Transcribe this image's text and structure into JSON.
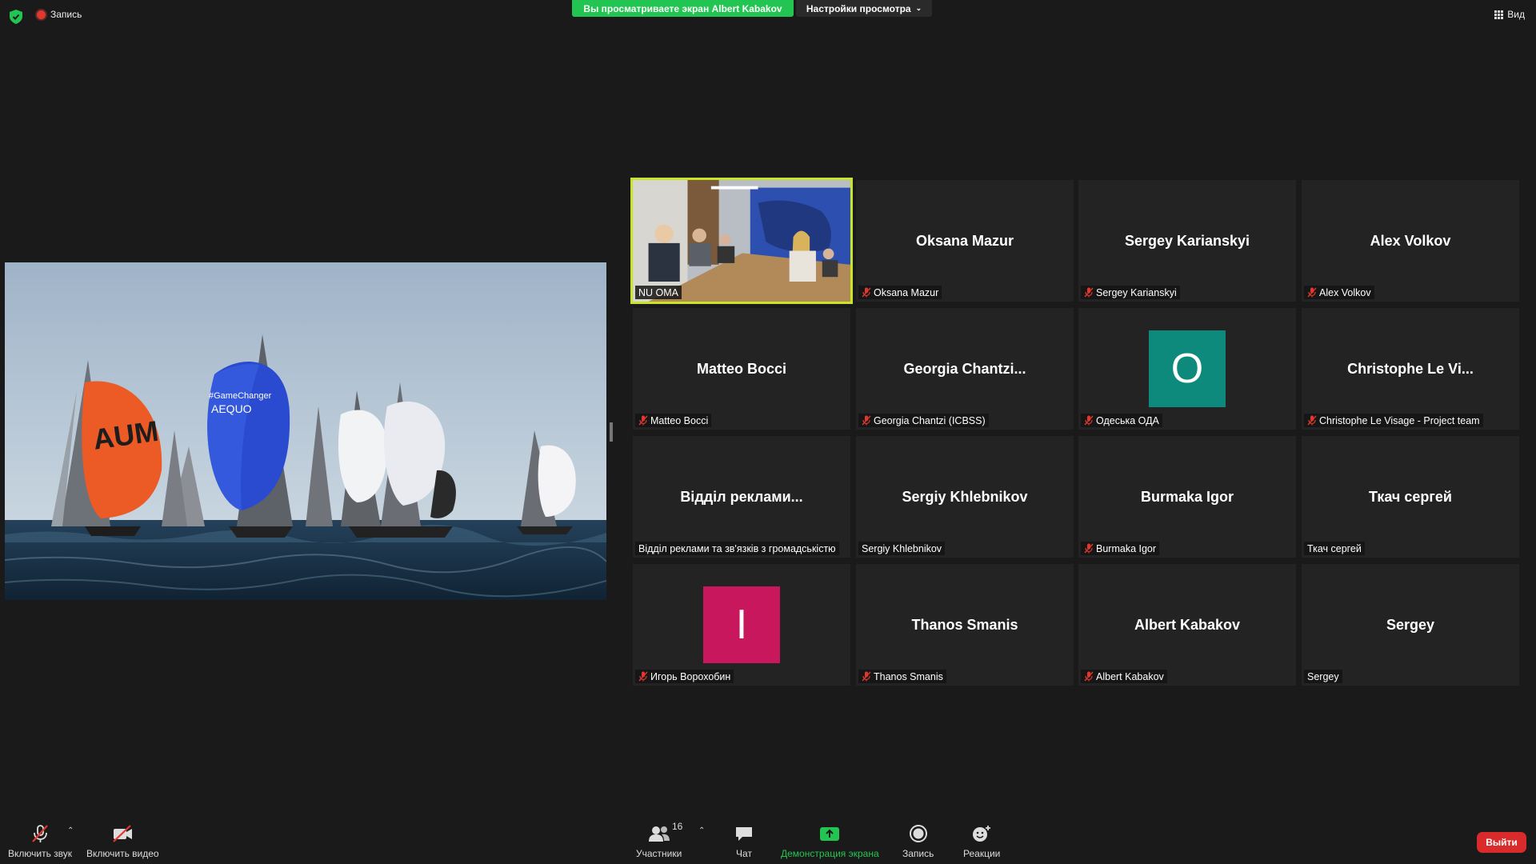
{
  "topbar": {
    "recording_label": "Запись",
    "share_banner": "Вы просматриваете экран Albert Kabakov",
    "view_options": "Настройки просмотра",
    "view_button": "Вид"
  },
  "participants": [
    {
      "display": "",
      "label": "NU OMA",
      "muted": false,
      "video": true,
      "active": true
    },
    {
      "display": "Oksana Mazur",
      "label": "Oksana Mazur",
      "muted": true
    },
    {
      "display": "Sergey Karianskyi",
      "label": "Sergey Karianskyi",
      "muted": true
    },
    {
      "display": "Alex Volkov",
      "label": "Alex Volkov",
      "muted": true
    },
    {
      "display": "Matteo Bocci",
      "label": "Matteo Bocci",
      "muted": true
    },
    {
      "display": "Georgia  Chantzi...",
      "label": "Georgia Chantzi (ICBSS)",
      "muted": true
    },
    {
      "avatar": "О",
      "avatar_color": "#0e8a7c",
      "label": "Одеська ОДА",
      "muted": true
    },
    {
      "display": "Christophe Le Vi...",
      "label": "Christophe Le Visage - Project team",
      "muted": true
    },
    {
      "display": "Відділ  реклами...",
      "label": "Відділ реклами та зв'язків з громадськістю",
      "muted": false
    },
    {
      "display": "Sergiy Khlebnikov",
      "label": "Sergiy Khlebnikov",
      "muted": false
    },
    {
      "display": "Burmaka Igor",
      "label": "Burmaka Igor",
      "muted": true
    },
    {
      "display": "Ткач сергей",
      "label": "Ткач сергей",
      "muted": false
    },
    {
      "avatar": "I",
      "avatar_color": "#c8175d",
      "label": "Игорь Ворохобин",
      "muted": true
    },
    {
      "display": "Thanos Smanis",
      "label": "Thanos Smanis",
      "muted": true
    },
    {
      "display": "Albert Kabakov",
      "label": "Albert Kabakov",
      "muted": true
    },
    {
      "display": "Sergey",
      "label": "Sergey",
      "muted": false
    }
  ],
  "shared_screen": {
    "sail_text_1": "AUM",
    "sail_text_2": "#GameChanger",
    "sail_text_3": "AEQUO"
  },
  "toolbar": {
    "audio": "Включить звук",
    "video": "Включить видео",
    "participants": "Участники",
    "participants_count": "16",
    "chat": "Чат",
    "share": "Демонстрация экрана",
    "record": "Запись",
    "reactions": "Реакции",
    "leave": "Выйти"
  },
  "colors": {
    "share_green": "#23c552",
    "active_speaker": "#c9e32c",
    "leave_red": "#d92b2b"
  }
}
